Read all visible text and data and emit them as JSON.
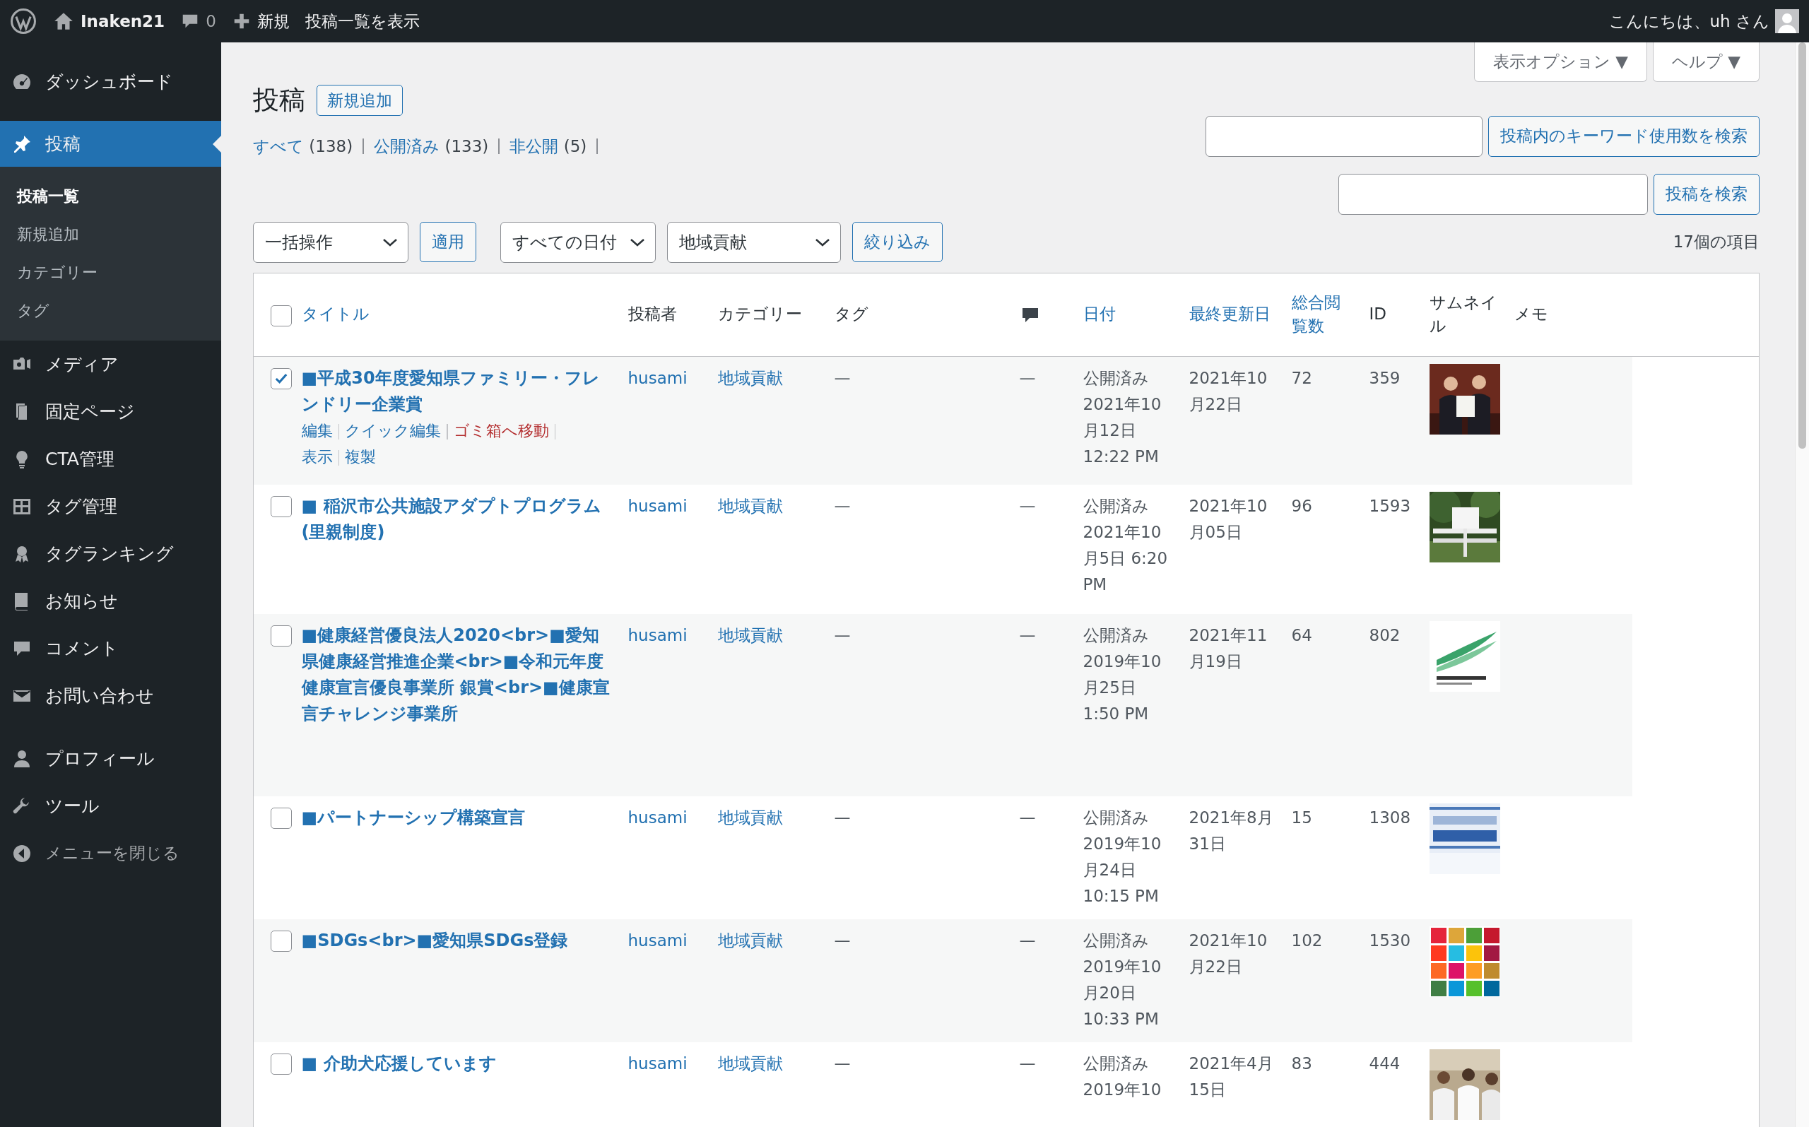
{
  "topbar": {
    "site": "Inaken21",
    "comments": "0",
    "new": "新規",
    "view": "投稿一覧を表示",
    "greeting": "こんにちは、uh さん"
  },
  "sidebar": {
    "sections": [
      {
        "items": [
          {
            "label": "ダッシュボード",
            "selected": false
          }
        ]
      },
      {
        "items": [
          {
            "label": "投稿",
            "selected": true,
            "children": [
              {
                "label": "投稿一覧",
                "selected": true
              },
              {
                "label": "新規追加",
                "selected": false
              },
              {
                "label": "カテゴリー",
                "selected": false
              },
              {
                "label": "タグ",
                "selected": false
              }
            ]
          },
          {
            "label": "メディア",
            "selected": false
          },
          {
            "label": "固定ページ",
            "selected": false
          },
          {
            "label": "CTA管理",
            "selected": false
          },
          {
            "label": "タグ管理",
            "selected": false
          },
          {
            "label": "タグランキング",
            "selected": false
          },
          {
            "label": "お知らせ",
            "selected": false
          },
          {
            "label": "コメント",
            "selected": false
          },
          {
            "label": "お問い合わせ",
            "selected": false
          }
        ]
      },
      {
        "items": [
          {
            "label": "プロフィール",
            "selected": false
          },
          {
            "label": "ツール",
            "selected": false
          },
          {
            "label": "メニューを閉じる",
            "selected": false,
            "kind": "collapse"
          }
        ]
      }
    ]
  },
  "screen_tabs": [
    {
      "label": "表示オプション ▼"
    },
    {
      "label": "ヘルプ ▼"
    }
  ],
  "page_title": "投稿",
  "add_new": "新規追加",
  "views": [
    {
      "label": "すべて",
      "count": "(138)"
    },
    {
      "label": "公開済み",
      "count": "(133)"
    },
    {
      "label": "非公開",
      "count": "(5)"
    }
  ],
  "keyword_search": {
    "button": "投稿内のキーワード使用数を検索"
  },
  "post_search": {
    "button": "投稿を検索"
  },
  "filters": {
    "bulk_action": "一括操作",
    "apply": "適用",
    "date": "すべての日付",
    "category": "地域貢献",
    "filter_button": "絞り込み",
    "item_count": "17個の項目"
  },
  "table": {
    "select_all": {
      "checked": false
    },
    "columns": [
      {
        "label": "タイトル",
        "kind": "link"
      },
      {
        "label": "投稿者",
        "kind": "text"
      },
      {
        "label": "カテゴリー",
        "kind": "text"
      },
      {
        "label": "タグ",
        "kind": "text"
      },
      {
        "kind": "icon"
      },
      {
        "label": "日付",
        "kind": "link"
      },
      {
        "label": "最終更新日",
        "kind": "link"
      },
      {
        "label": "総合閲覧数",
        "kind": "link"
      },
      {
        "label": "ID",
        "kind": "text"
      },
      {
        "label": "サムネイル",
        "kind": "text"
      },
      {
        "label": "メモ",
        "kind": "text"
      }
    ],
    "rows": [
      {
        "checked": true,
        "title": "■平成30年度愛知県ファミリー・フレンドリー企業賞",
        "actions": [
          {
            "label": "編集",
            "kind": "link"
          },
          {
            "label": "クイック編集",
            "kind": "link"
          },
          {
            "label": "ゴミ箱へ移動",
            "kind": "danger"
          },
          {
            "label": "表示",
            "kind": "link"
          },
          {
            "label": "複製",
            "kind": "link"
          }
        ],
        "author": "husami",
        "category": "地域貢献",
        "tags": "—",
        "comments": "—",
        "date_lines": [
          "公開済み",
          "2021年10",
          "月12日",
          "12:22 PM"
        ],
        "updated_lines": [
          "2021年10",
          "月22日"
        ],
        "views": "72",
        "id": "359",
        "thumbnail": {
          "kind": "picture"
        }
      },
      {
        "checked": false,
        "title": "■ 稲沢市公共施設アダプトプログラム(里親制度)",
        "author": "husami",
        "category": "地域貢献",
        "tags": "—",
        "comments": "—",
        "date_lines": [
          "公開済み",
          "2021年10",
          "月5日 6:20",
          "PM"
        ],
        "updated_lines": [
          "2021年10",
          "月05日"
        ],
        "views": "96",
        "id": "1593",
        "thumbnail": {
          "kind": "picture"
        }
      },
      {
        "checked": false,
        "title": "■健康経営優良法人2020<br>■愛知県健康経営推進企業<br>■令和元年度健康宣言優良事業所 銀賞<br>■健康宣言チャレンジ事業所",
        "author": "husami",
        "category": "地域貢献",
        "tags": "—",
        "comments": "—",
        "date_lines": [
          "公開済み",
          "2019年10",
          "月25日",
          "1:50 PM"
        ],
        "updated_lines": [
          "2021年11",
          "月19日"
        ],
        "views": "64",
        "id": "802",
        "thumbnail": {
          "kind": "picture"
        }
      },
      {
        "checked": false,
        "title": "■パートナーシップ構築宣言",
        "author": "husami",
        "category": "地域貢献",
        "tags": "—",
        "comments": "—",
        "date_lines": [
          "公開済み",
          "2019年10",
          "月24日",
          "10:15 PM"
        ],
        "updated_lines": [
          "2021年8月",
          "31日"
        ],
        "views": "15",
        "id": "1308",
        "thumbnail": {
          "kind": "picture"
        }
      },
      {
        "checked": false,
        "title": "■SDGs<br>■愛知県SDGs登録",
        "author": "husami",
        "category": "地域貢献",
        "tags": "—",
        "comments": "—",
        "date_lines": [
          "公開済み",
          "2019年10",
          "月20日",
          "10:33 PM"
        ],
        "updated_lines": [
          "2021年10",
          "月22日"
        ],
        "views": "102",
        "id": "1530",
        "thumbnail": {
          "kind": "picture"
        }
      },
      {
        "checked": false,
        "title": "■ 介助犬応援しています",
        "author": "husami",
        "category": "地域貢献",
        "tags": "—",
        "comments": "—",
        "date_lines": [
          "公開済み",
          "2019年10"
        ],
        "updated_lines": [
          "2021年4月",
          "15日"
        ],
        "views": "83",
        "id": "444",
        "thumbnail": {
          "kind": "picture"
        }
      }
    ]
  }
}
